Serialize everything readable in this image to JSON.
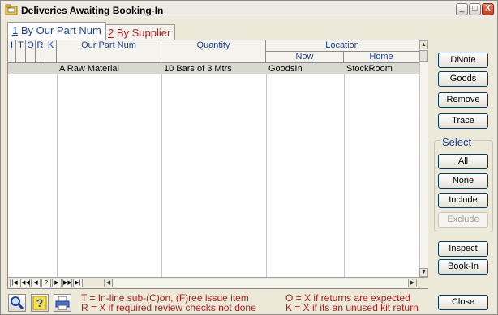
{
  "window": {
    "title": "Deliveries Awaiting Booking-In",
    "controls": {
      "minimize": "_",
      "maximize": "□",
      "close": "X"
    }
  },
  "tabs": [
    {
      "number": "1",
      "label": " By Our Part Num",
      "active": true
    },
    {
      "number": "2",
      "label": " By Supplier",
      "active": false
    }
  ],
  "grid": {
    "flag_headers": [
      "I",
      "T",
      "O",
      "R",
      "K"
    ],
    "headers": {
      "part_num": "Our Part Num",
      "quantity": "Quantity",
      "location": "Location",
      "now": "Now",
      "home": "Home"
    },
    "rows": [
      {
        "part_num": "A Raw Material",
        "quantity": "10 Bars of 3 Mtrs",
        "now": "GoodsIn",
        "home": "StockRoom"
      }
    ],
    "nav_buttons": [
      "|◀",
      "◀◀",
      "◀",
      "?",
      "▶",
      "▶▶",
      "▶|"
    ]
  },
  "buttons": {
    "dnote": "DNote",
    "goods": "Goods",
    "remove": "Remove",
    "trace": "Trace",
    "select_label": "Select",
    "all": "All",
    "none": "None",
    "include": "Include",
    "exclude": "Exclude",
    "inspect": "Inspect",
    "book_in": "Book-In",
    "close": "Close"
  },
  "legend": {
    "t_line": "T = In-line sub-(C)on, (F)ree issue item",
    "r_line": "R = X if required review checks not done",
    "o_line": "O = X if returns are expected",
    "k_line": "K = X if its an unused kit return"
  },
  "colors": {
    "accent_blue": "#1A3FA0",
    "legend_red": "#B01E1E",
    "window_bg": "#ECE9D8"
  },
  "toolbar_icons": [
    "search-icon",
    "help-icon",
    "print-icon"
  ]
}
